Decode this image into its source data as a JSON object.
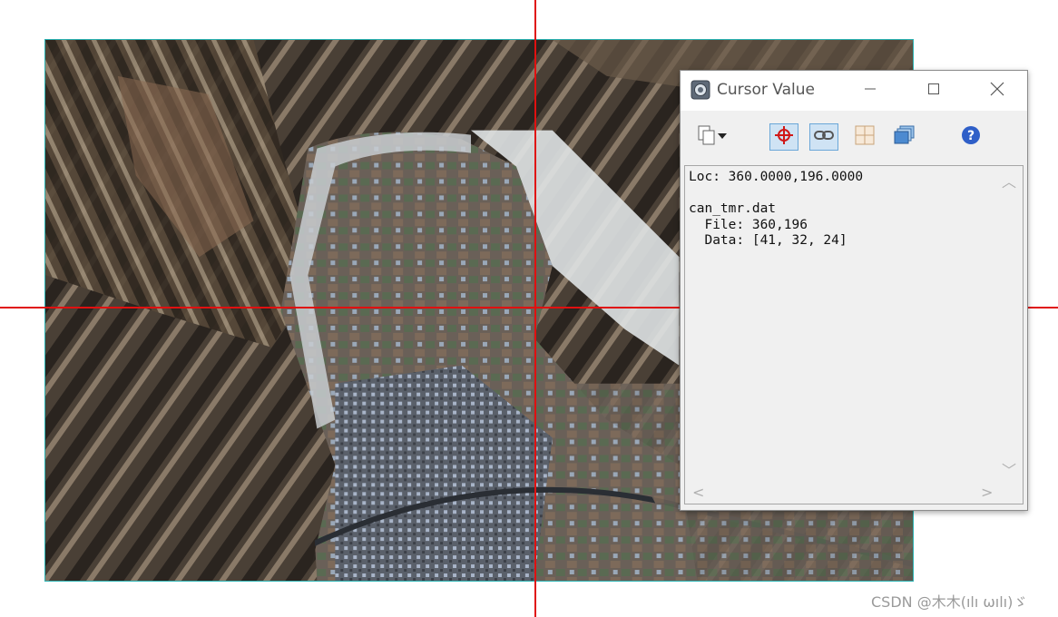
{
  "window": {
    "title": "Cursor Value",
    "controls": {
      "minimize": "minimize-icon",
      "maximize": "maximize-icon",
      "close": "close-icon"
    }
  },
  "toolbar": {
    "icons": [
      "copy-icon",
      "dropdown-arrow-icon",
      "locate-crosshair-icon",
      "link-icon",
      "grid-icon",
      "windows-icon",
      "help-icon"
    ],
    "help_label": "?"
  },
  "cursor_info": {
    "loc_line": "Loc: 360.0000,196.0000",
    "file_name": "can_tmr.dat",
    "file_line": "  File: 360,196",
    "data_line": "  Data: [41, 32, 24]"
  },
  "image": {
    "description_icon": "satellite-image",
    "crosshair_color": "#e01010",
    "border_color": "#2bb3b3"
  },
  "watermark": "CSDN @木木(ılı ωılı)ゞ"
}
